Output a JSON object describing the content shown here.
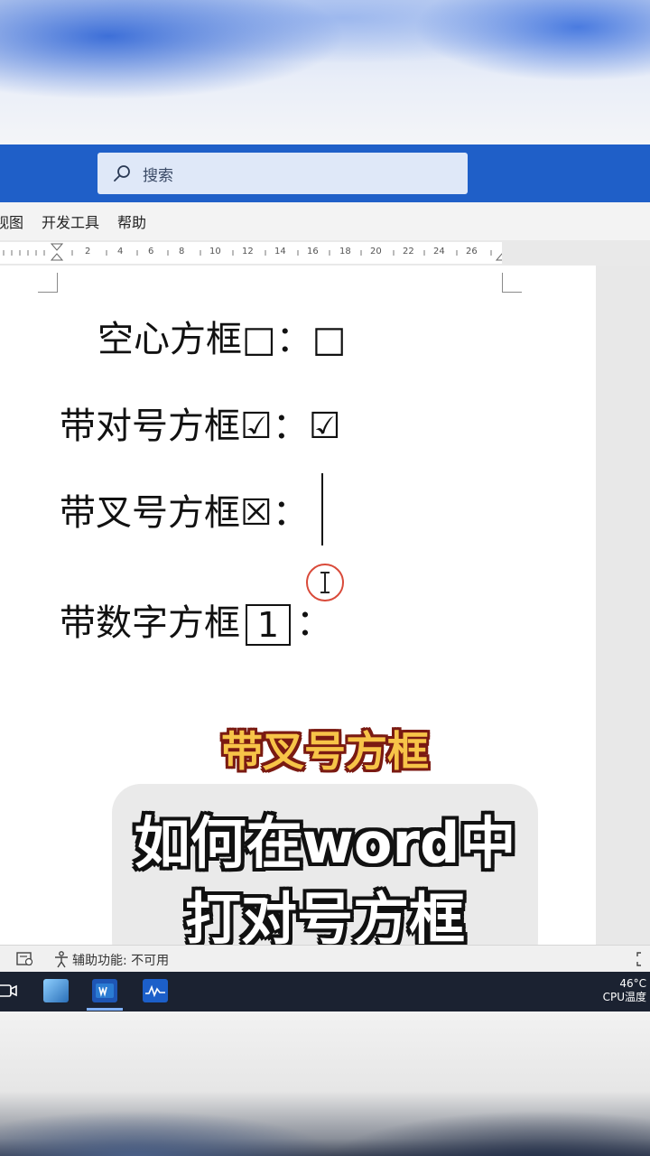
{
  "search": {
    "placeholder": "搜索"
  },
  "menu": {
    "tabs": [
      "视图",
      "开发工具",
      "帮助"
    ]
  },
  "ruler": {
    "marks": [
      "2",
      "4",
      "6",
      "8",
      "10",
      "12",
      "14",
      "16",
      "18",
      "20",
      "22",
      "24",
      "26"
    ]
  },
  "document": {
    "line1": "空心方框□：□",
    "line2": "带对号方框☑：☑",
    "line3": "带叉号方框☒：",
    "line4_prefix": "带数字方框",
    "line4_box": "1",
    "line4_suffix": "："
  },
  "overlay": {
    "subtitle": "带叉号方框",
    "title_line1": "如何在word中",
    "title_line2": "打对号方框"
  },
  "statusbar": {
    "accessibility": "辅助功能: 不可用"
  },
  "tray": {
    "temperature": "46°C",
    "label": "CPU温度"
  },
  "colors": {
    "titlebar": "#1f5fc8",
    "caption_yellow": "#f7c448",
    "marker_red": "#d94a3a"
  }
}
